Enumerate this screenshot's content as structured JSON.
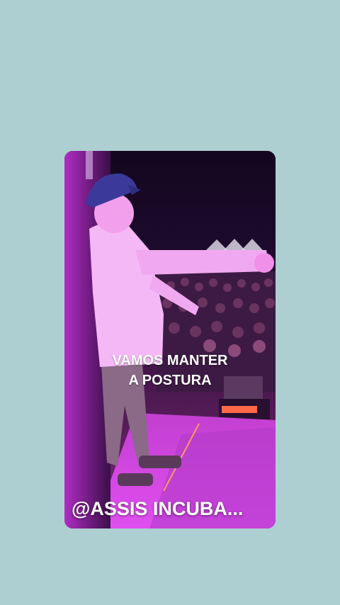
{
  "story": {
    "caption_line1": "VAMOS MANTER",
    "caption_line2": "A POSTURA",
    "handle": "@ASSIS INCUBA..."
  },
  "colors": {
    "background": "#aecfd1",
    "stage_light": "#ff3aff",
    "shirt": "#f5b8f7"
  }
}
